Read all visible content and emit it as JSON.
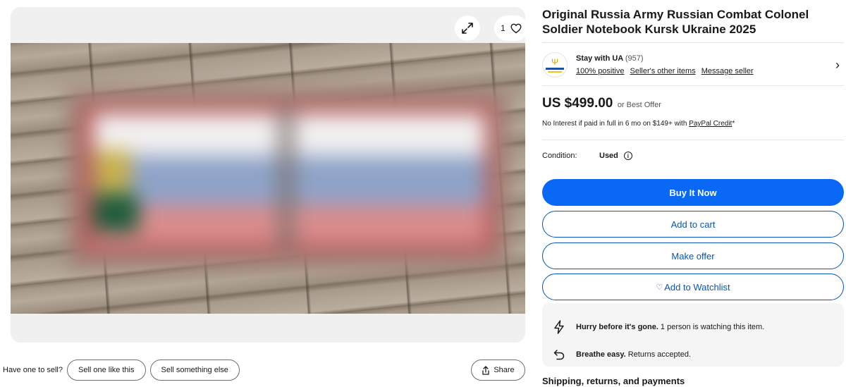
{
  "gallery": {
    "watch_count": "1",
    "expand_icon": "expand-icon",
    "heart_icon": "heart-icon"
  },
  "sell": {
    "label": "Have one to sell?",
    "sell_one": "Sell one like this",
    "sell_else": "Sell something else"
  },
  "share": {
    "label": "Share",
    "icon": "share-icon"
  },
  "listing": {
    "title": "Original Russia Army Russian Combat Colonel Soldier Notebook Kursk Ukraine 2025"
  },
  "seller": {
    "name": "Stay with UA",
    "feedback_count": "(957)",
    "positive": "100% positive",
    "other_items": "Seller's other items",
    "message": "Message seller"
  },
  "price": {
    "amount": "US $499.00",
    "suffix": "or Best Offer",
    "credit_text": "No Interest if paid in full in 6 mo on $149+ with ",
    "credit_link": "PayPal Credit",
    "credit_mark": "*"
  },
  "condition": {
    "label": "Condition:",
    "value": "Used"
  },
  "buttons": {
    "buy_now": "Buy It Now",
    "add_to_cart": "Add to cart",
    "make_offer": "Make offer",
    "watchlist": "Add to Watchlist"
  },
  "urgency": {
    "hurry_bold": "Hurry before it's gone.",
    "hurry_text": "1 person is watching this item.",
    "returns_bold": "Breathe easy.",
    "returns_text": "Returns accepted."
  },
  "shipping": {
    "title": "Shipping, returns, and payments"
  },
  "colors": {
    "primary": "#0968f6",
    "link": "#0654ba"
  }
}
